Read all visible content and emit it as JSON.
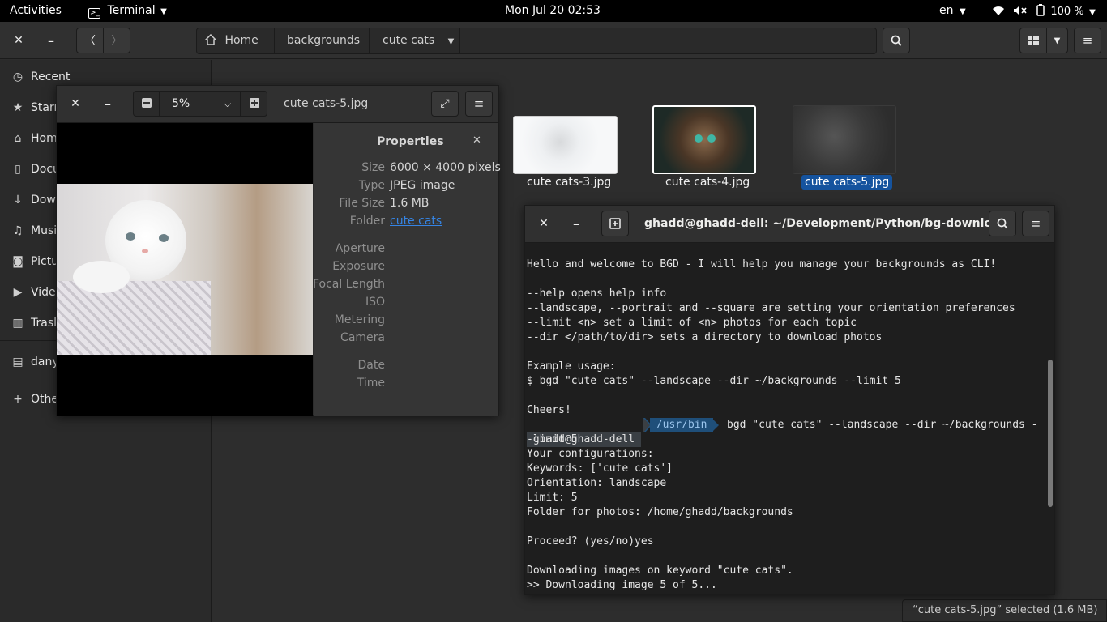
{
  "topbar": {
    "activities": "Activities",
    "app_name": "Terminal",
    "clock": "Mon Jul 20  02:53",
    "language": "en",
    "battery": "100 %"
  },
  "files": {
    "path": [
      "Home",
      "backgrounds",
      "cute cats"
    ],
    "sidebar": [
      {
        "label": "Recent",
        "icon": "clock-icon"
      },
      {
        "label": "Starr",
        "icon": "star-icon"
      },
      {
        "label": "Hom",
        "icon": "home-icon"
      },
      {
        "label": "Docu",
        "icon": "document-icon"
      },
      {
        "label": "Dow",
        "icon": "download-icon"
      },
      {
        "label": "Musi",
        "icon": "music-icon"
      },
      {
        "label": "Pictu",
        "icon": "camera-icon"
      },
      {
        "label": "Vide",
        "icon": "video-icon"
      },
      {
        "label": "Trasl",
        "icon": "trash-icon"
      },
      {
        "label": "dany",
        "icon": "drive-icon"
      },
      {
        "label": "Othe",
        "icon": "plus-icon"
      }
    ],
    "items": [
      {
        "name": "cute cats-3.jpg"
      },
      {
        "name": "cute cats-4.jpg"
      },
      {
        "name": "cute cats-5.jpg"
      }
    ],
    "status": "“cute cats-5.jpg” selected  (1.6 MB)"
  },
  "viewer": {
    "zoom": "5%",
    "title": "cute cats-5.jpg",
    "properties_title": "Properties",
    "properties": [
      {
        "key": "Size",
        "value": "6000 × 4000 pixels"
      },
      {
        "key": "Type",
        "value": "JPEG image"
      },
      {
        "key": "File Size",
        "value": "1.6 MB"
      },
      {
        "key": "Folder",
        "value": "cute cats"
      },
      {
        "key": "Aperture",
        "value": ""
      },
      {
        "key": "Exposure",
        "value": ""
      },
      {
        "key": "Focal Length",
        "value": ""
      },
      {
        "key": "ISO",
        "value": ""
      },
      {
        "key": "Metering",
        "value": ""
      },
      {
        "key": "Camera",
        "value": ""
      },
      {
        "key": "Date",
        "value": ""
      },
      {
        "key": "Time",
        "value": ""
      }
    ]
  },
  "terminal": {
    "title": "ghadd@ghadd-dell: ~/Development/Python/bg-downloa...",
    "lines_before": [
      "Hello and welcome to BGD - I will help you manage your backgrounds as CLI!",
      "",
      "--help opens help info",
      "--landscape, --portrait and --square are setting your orientation preferences",
      "--limit <n> set a limit of <n> photos for each topic",
      "--dir </path/to/dir> sets a directory to download photos",
      "",
      "Example usage:",
      "$ bgd \"cute cats\" --landscape --dir ~/backgrounds --limit 5",
      "",
      "Cheers!"
    ],
    "prompt_user": " ghadd@ghadd-dell ",
    "prompt_dir": " /usr/bin ",
    "prompt_cmd": "bgd \"cute cats\" --landscape --dir ~/backgrounds -",
    "lines_after": [
      "-limit 5",
      "Your configurations:",
      "Keywords: ['cute cats']",
      "Orientation: landscape",
      "Limit: 5",
      "Folder for photos: /home/ghadd/backgrounds",
      "",
      "Proceed? (yes/no)yes",
      "",
      "Downloading images on keyword \"cute cats\".",
      ">> Downloading image 5 of 5..."
    ]
  },
  "colors": {
    "accent": "#15539e",
    "link": "#3584e4",
    "prompt_user_bg": "#3a3f44",
    "prompt_dir_bg": "#1f4f7a"
  }
}
